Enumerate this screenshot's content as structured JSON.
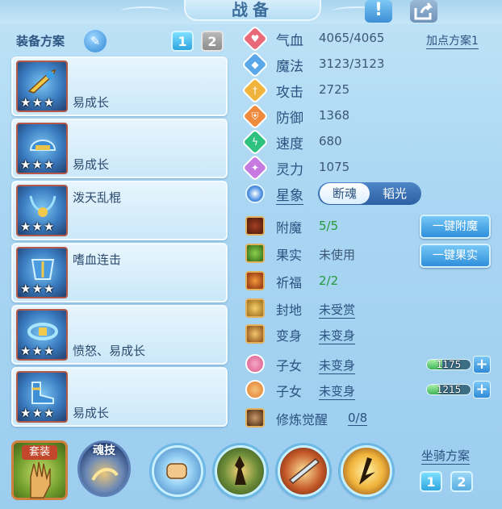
{
  "window": {
    "title": "战备",
    "info_icon": "exclamation-icon",
    "share_icon": "share-icon"
  },
  "equipment_plan": {
    "title": "装备方案",
    "edit_icon": "pencil-icon",
    "plans": [
      "1",
      "2"
    ],
    "active_plan": "1",
    "items": [
      {
        "stars": "★★★",
        "effect": "易成长"
      },
      {
        "stars": "★★★",
        "effect": "易成长"
      },
      {
        "stars": "★★★",
        "effect": "泼天乱棍"
      },
      {
        "stars": "★★★",
        "effect": "嗜血连击"
      },
      {
        "stars": "★★★",
        "effect": "愤怒、易成长"
      },
      {
        "stars": "★★★",
        "effect": "易成长"
      }
    ]
  },
  "stats": {
    "point_plan_link": "加点方案1",
    "rows": [
      {
        "label": "气血",
        "value": "4065/4065",
        "icon": "heart-icon",
        "color": "#e86a7a"
      },
      {
        "label": "魔法",
        "value": "3123/3123",
        "icon": "mana-icon",
        "color": "#5aa8ea"
      },
      {
        "label": "攻击",
        "value": "2725",
        "icon": "sword-icon",
        "color": "#f0b43c"
      },
      {
        "label": "防御",
        "value": "1368",
        "icon": "shield-icon",
        "color": "#ef8a3c"
      },
      {
        "label": "速度",
        "value": "680",
        "icon": "lightning-icon",
        "color": "#2fc17f"
      },
      {
        "label": "灵力",
        "value": "1075",
        "icon": "spirit-icon",
        "color": "#c77ae0"
      }
    ]
  },
  "constellation": {
    "label": "星象",
    "options": [
      "断魂",
      "韬光"
    ],
    "selected": "断魂"
  },
  "attributes": [
    {
      "label": "附魔",
      "value": "5/5",
      "style": "green",
      "icon": "enchant-icon"
    },
    {
      "label": "果实",
      "value": "未使用",
      "style": "plain",
      "icon": "fruit-icon"
    },
    {
      "label": "祈福",
      "value": "2/2",
      "style": "green",
      "icon": "blessing-icon"
    },
    {
      "label": "封地",
      "value": "未受赏",
      "style": "link",
      "icon": "fief-icon"
    },
    {
      "label": "变身",
      "value": "未变身",
      "style": "link",
      "icon": "transform-icon"
    },
    {
      "label": "子女",
      "value": "未变身",
      "style": "link",
      "icon": "child-lotus-icon"
    },
    {
      "label": "子女",
      "value": "未变身",
      "style": "link",
      "icon": "child-orange-icon"
    },
    {
      "label": "修炼觉醒",
      "value": "0/8",
      "style": "link",
      "icon": "cultivation-icon"
    }
  ],
  "buttons": {
    "one_click_enchant": "一键附魔",
    "one_click_fruit": "一键果实"
  },
  "children_exp": [
    {
      "value": "1175",
      "fill": 0.35
    },
    {
      "value": "1215",
      "fill": 0.3
    }
  ],
  "bottom_bar": {
    "suit_label": "套装",
    "soul_skill_label": "魂技",
    "skills": [
      "fist-skill-icon",
      "warrior-skill-icon",
      "blade-skill-icon",
      "slash-skill-icon"
    ],
    "mount_plan_title": "坐骑方案",
    "mount_plans": [
      "1",
      "2"
    ]
  }
}
